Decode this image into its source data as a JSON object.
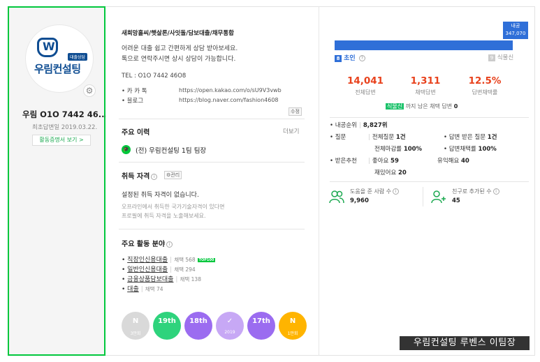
{
  "profile": {
    "logo_tag": "대출상담",
    "logo_text": "우림컨설팅",
    "name": "우림 O1O 7442 46...",
    "first_answer_date": "최초답변일 2019.03.22.",
    "certificate_button": "활동증명서 보기 >"
  },
  "intro": {
    "title": "새희망홀씨/햇살론/사잇돌/담보대출/채무통합",
    "line1": "어려운 대출 쉽고 간편하게 상담 받아보세요.",
    "line2": "톡으로 연락주시면 상시 상담이 가능합니다.",
    "tel": "TEL : O1O 7442 46O8",
    "links": [
      {
        "label": "• 카 카 톡",
        "url": "https://open.kakao.com/o/sU9V3vwb"
      },
      {
        "label": "• 블로그",
        "url": "https://blog.naver.com/fashion4608"
      }
    ],
    "edit_label": "수정"
  },
  "career": {
    "title": "주요 이력",
    "more": "더보기",
    "item": "(전) 우림컨설팅 1팀 팀장"
  },
  "certification": {
    "title": "취득 자격",
    "manage_label": "⚙관리",
    "empty": "설정된 취득 자격이 없습니다.",
    "hint1": "오프라인에서 취득한 국가기술자격이 있다면",
    "hint2": "프로필에 취득 자격을 노출해보세요."
  },
  "fields": {
    "title": "주요 활동 분야",
    "items": [
      {
        "name": "직장인신용대출",
        "count": "채택 568",
        "badge": "TOP100"
      },
      {
        "name": "일반인신용대출",
        "count": "채택 294",
        "badge": ""
      },
      {
        "name": "금융상품담보대출",
        "count": "채택 138",
        "badge": ""
      },
      {
        "name": "대출",
        "count": "채택 74",
        "badge": ""
      }
    ]
  },
  "badges": [
    {
      "label": "N",
      "sub": "3만회",
      "color": "#d9d9d9"
    },
    {
      "label": "19th",
      "sub": "",
      "color": "#2ed37c"
    },
    {
      "label": "18th",
      "sub": "",
      "color": "#9b6cf0"
    },
    {
      "label": "✓",
      "sub": "2019",
      "color": "#c7a8f5"
    },
    {
      "label": "17th",
      "sub": "",
      "color": "#9b6cf0"
    },
    {
      "label": "N",
      "sub": "1만회",
      "color": "#ffb400"
    }
  ],
  "rank": {
    "tip_label": "내공",
    "tip_value": "347,070",
    "current_num": "8",
    "current_name": "초인",
    "next_num": "9",
    "next_name": "식물신",
    "progress": 0.96
  },
  "stats": [
    {
      "value": "14,041",
      "label": "전체답변"
    },
    {
      "value": "1,311",
      "label": "채택답변"
    },
    {
      "value": "12.5%",
      "label": "답변채택률"
    }
  ],
  "next_rank_note": {
    "highlight": "식물신",
    "text": "까지 남은 채택 답변",
    "value": "0"
  },
  "details": {
    "naegong_rank_label": "• 내공순위",
    "naegong_rank_value": "8,827위",
    "question_label": "• 질문",
    "total_questions_label": "전체질문",
    "total_questions_value": "1건",
    "answered_questions_label": "• 답변 받은 질문",
    "answered_questions_value": "1건",
    "deadline_rate_label": "전체마감률",
    "deadline_rate_value": "100%",
    "adopt_rate_label": "• 답변채택률",
    "adopt_rate_value": "100%",
    "recommend_label": "• 받은추천",
    "good_label": "좋아요",
    "good_value": "59",
    "useful_label": "유익해요",
    "useful_value": "40",
    "fun_label": "재밌어요",
    "fun_value": "20"
  },
  "social": {
    "helped_label": "도움을 준 사람 수",
    "helped_value": "9,960",
    "friends_label": "친구로 추가된 수",
    "friends_value": "45"
  },
  "watermark": "우림컨설팅 루벤스 이팀장"
}
